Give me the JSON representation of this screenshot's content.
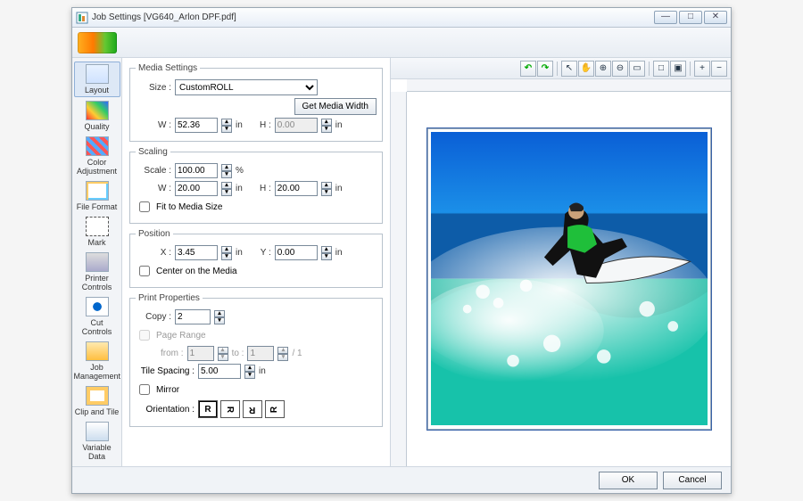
{
  "window": {
    "title": "Job Settings [VG640_Arlon DPF.pdf]",
    "min": "—",
    "max": "□",
    "close": "✕"
  },
  "sidebar": {
    "items": [
      {
        "label": "Layout"
      },
      {
        "label": "Quality"
      },
      {
        "label": "Color\nAdjustment"
      },
      {
        "label": "File Format"
      },
      {
        "label": "Mark"
      },
      {
        "label": "Printer\nControls"
      },
      {
        "label": "Cut\nControls"
      },
      {
        "label": "Job\nManagement"
      },
      {
        "label": "Clip and Tile"
      },
      {
        "label": "Variable\nData"
      }
    ]
  },
  "media": {
    "legend": "Media Settings",
    "size_label": "Size :",
    "size_value": "CustomROLL",
    "get_width": "Get Media Width",
    "w_label": "W :",
    "w_value": "52.36",
    "w_unit": "in",
    "h_label": "H :",
    "h_value": "0.00",
    "h_unit": "in"
  },
  "scaling": {
    "legend": "Scaling",
    "scale_label": "Scale :",
    "scale_value": "100.00",
    "scale_unit": "%",
    "w_label": "W :",
    "w_value": "20.00",
    "w_unit": "in",
    "h_label": "H :",
    "h_value": "20.00",
    "h_unit": "in",
    "fit_label": "Fit to Media Size"
  },
  "position": {
    "legend": "Position",
    "x_label": "X :",
    "x_value": "3.45",
    "x_unit": "in",
    "y_label": "Y :",
    "y_value": "0.00",
    "y_unit": "in",
    "center_label": "Center on the Media"
  },
  "print": {
    "legend": "Print Properties",
    "copy_label": "Copy :",
    "copy_value": "2",
    "range_label": "Page Range",
    "from_label": "from :",
    "from_value": "1",
    "to_label": "to :",
    "to_value": "1",
    "of": "/ 1",
    "tile_label": "Tile Spacing :",
    "tile_value": "5.00",
    "tile_unit": "in",
    "mirror_label": "Mirror",
    "orient_label": "Orientation :",
    "orient_glyph": "R"
  },
  "ptool": {
    "undo": "↶",
    "redo": "↷",
    "sep": "|",
    "arrow": "↖",
    "hand": "✋",
    "zoomin": "⊕",
    "zoomout": "⊖",
    "fit": "▭",
    "sq1": "□",
    "sq2": "▣",
    "plus": "+",
    "minus": "−"
  },
  "footer": {
    "ok": "OK",
    "cancel": "Cancel"
  }
}
